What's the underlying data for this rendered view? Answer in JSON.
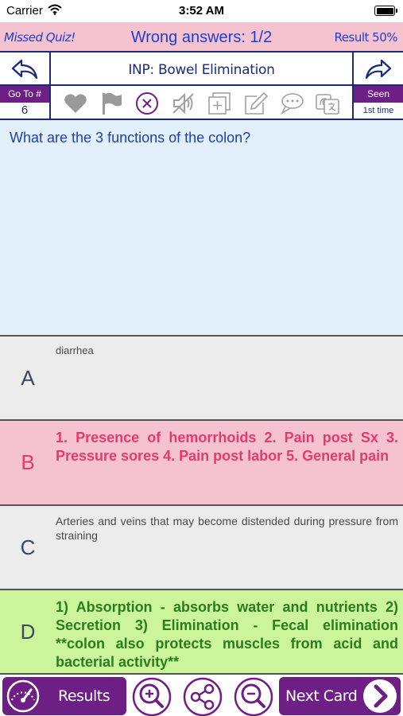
{
  "status_bar": {
    "carrier": "Carrier",
    "time": "3:52 AM"
  },
  "header": {
    "missed_quiz": "Missed Quiz!",
    "wrong_answers": "Wrong answers: 1/2",
    "result": "Result 50%"
  },
  "title_bar": {
    "title": "INP: Bowel Elimination"
  },
  "toolbar": {
    "goto_label": "Go To #",
    "goto_value": "6",
    "seen_label": "Seen",
    "seen_value": "1st time",
    "icons": [
      "heart-icon",
      "flag-icon",
      "close-circle-icon",
      "mute-icon",
      "add-box-icon",
      "edit-icon",
      "chat-icon",
      "translate-icon"
    ]
  },
  "question": {
    "text": "What are the 3 functions of the colon?"
  },
  "answers": [
    {
      "letter": "A",
      "text": "diarrhea",
      "state": "neutral"
    },
    {
      "letter": "B",
      "text": "1. Presence of hemorrhoids 2. Pain post Sx 3. Pressure sores 4. Pain post labor 5. General pain",
      "state": "wrong"
    },
    {
      "letter": "C",
      "text": "Arteries and veins that may become distended during pressure from straining",
      "state": "neutral"
    },
    {
      "letter": "D",
      "text": "1) Absorption - absorbs water and nutrients 2) Secretion 3) Elimination - Fecal elimination **colon also protects muscles from acid and bacterial activity**",
      "state": "correct"
    }
  ],
  "bottom_bar": {
    "results_label": "Results",
    "next_label": "Next Card",
    "icons": [
      "gauge-icon",
      "zoom-in-icon",
      "share-icon",
      "zoom-out-icon",
      "chevron-right-icon"
    ]
  },
  "colors": {
    "header_bg": "#f5c2d0",
    "accent_purple": "#6e1f85",
    "navy": "#1b2a78",
    "question_bg": "#e1f0fb",
    "wrong_text": "#e53a6d",
    "correct_bg": "#ccf49a",
    "correct_text": "#2a7d1e"
  }
}
